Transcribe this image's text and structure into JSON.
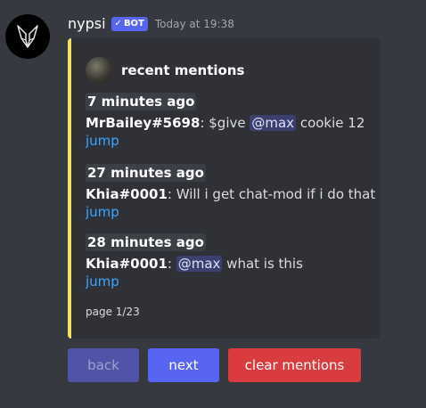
{
  "message": {
    "username": "nypsi",
    "bot_badge": "BOT",
    "timestamp": "Today at 19:38"
  },
  "embed": {
    "accent_color": "#f2e35e",
    "author": "recent mentions",
    "mentions": [
      {
        "time": "7 minutes ago",
        "user": "MrBailey#5698",
        "sep": ": ",
        "text_before": "$give ",
        "ping": "@max",
        "text_after": " cookie 12",
        "link": "jump"
      },
      {
        "time": "27 minutes ago",
        "user": "Khia#0001",
        "sep": ": ",
        "text_before": "Will i get chat-mod if i do that",
        "link": "jump"
      },
      {
        "time": "28 minutes ago",
        "user": "Khia#0001",
        "sep": ": ",
        "text_before": "",
        "ping": "@max",
        "text_after": " what is this",
        "link": "jump"
      }
    ],
    "footer": "page 1/23"
  },
  "buttons": {
    "back": "back",
    "next": "next",
    "clear": "clear mentions"
  },
  "colors": {
    "background": "#36393f",
    "embed_bg": "#2f3136",
    "blurple": "#5865f2",
    "danger": "#d83c3e",
    "link": "#3ea6ff"
  }
}
